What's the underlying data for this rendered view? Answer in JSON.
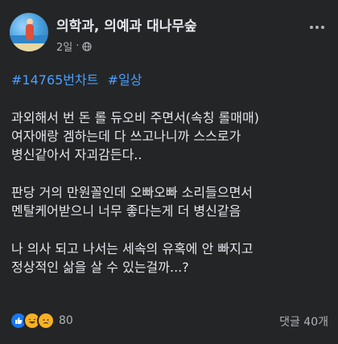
{
  "post": {
    "page_name": "의학과, 의예과 대나무숲",
    "time": "2일",
    "dot": "·",
    "hashtags": [
      "#14765번차트",
      "#일상"
    ],
    "paragraphs": [
      [
        "과외해서 번 돈 롤 듀오비 주면서(속칭 롤매매)",
        "여자애랑 겜하는데 다 쓰고나니까 스스로가",
        "병신같아서 자괴감든다.."
      ],
      [
        "판당 거의 만원꼴인데 오빠오빠 소리들으면서",
        "멘탈케어받으니 너무 좋다는게 더 병신같음"
      ],
      [
        "나 의사 되고 나서는 세속의 유혹에 안 빠지고",
        "정상적인 삶을 살 수 있는걸까...?"
      ]
    ]
  },
  "footer": {
    "reactions": [
      "like-icon",
      "haha-icon",
      "sad-icon"
    ],
    "reaction_count": "80",
    "comments": "댓글 40개"
  },
  "colors": {
    "background": "#242526",
    "text": "#e4e6eb",
    "secondary": "#b0b3b8",
    "link": "#4a9eff",
    "like": "#1877f2"
  }
}
